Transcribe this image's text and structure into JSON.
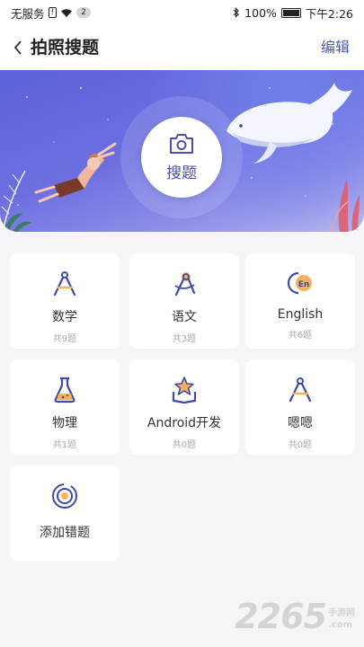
{
  "status_bar": {
    "carrier": "无服务",
    "sim_badge": "!",
    "wifi_badge": "2",
    "battery": "100%",
    "time": "下午2:26"
  },
  "header": {
    "title": "拍照搜题",
    "edit_label": "编辑"
  },
  "banner": {
    "search_label": "搜题"
  },
  "subjects": [
    {
      "name": "数学",
      "count": "共9题",
      "icon": "compass-icon"
    },
    {
      "name": "语文",
      "count": "共3题",
      "icon": "compass-drafting-icon"
    },
    {
      "name": "English",
      "count": "共6题",
      "icon": "english-bubble-icon"
    },
    {
      "name": "物理",
      "count": "共1题",
      "icon": "flask-icon"
    },
    {
      "name": "Android开发",
      "count": "共0题",
      "icon": "star-book-icon"
    },
    {
      "name": "嗯嗯",
      "count": "共0题",
      "icon": "compass-icon"
    }
  ],
  "add_card": {
    "label": "添加错题",
    "icon": "target-icon"
  },
  "watermark": {
    "number": "2265",
    "cn": "手游网",
    "domain": ".com"
  },
  "colors": {
    "accent": "#4a5ab8",
    "icon_orange": "#f0b35a",
    "banner": "#6a6fe0"
  }
}
